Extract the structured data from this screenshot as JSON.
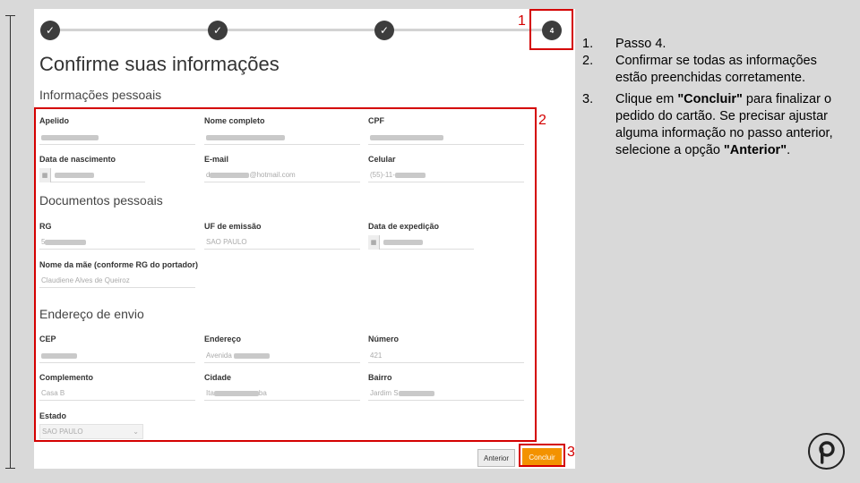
{
  "stepper": {
    "step4_label": "4"
  },
  "page_title": "Confirme suas informações",
  "sections": {
    "personal": "Informações pessoais",
    "documents": "Documentos pessoais",
    "address": "Endereço de envio"
  },
  "fields": {
    "apelido": {
      "label": "Apelido",
      "value": ""
    },
    "nome": {
      "label": "Nome completo",
      "value": ""
    },
    "cpf": {
      "label": "CPF",
      "value": ""
    },
    "nascimento": {
      "label": "Data de nascimento",
      "value": ""
    },
    "email": {
      "label": "E-mail",
      "prefix": "d",
      "suffix": "@hotmail.com"
    },
    "celular": {
      "label": "Celular",
      "prefix": "(55)-11-"
    },
    "rg": {
      "label": "RG",
      "prefix": "5"
    },
    "uf": {
      "label": "UF de emissão",
      "value": "SAO PAULO"
    },
    "expedicao": {
      "label": "Data de expedição",
      "value": ""
    },
    "mae": {
      "label": "Nome da mãe (conforme RG do portador)",
      "value": "Claudiene Alves de Queiroz"
    },
    "cep": {
      "label": "CEP",
      "value": ""
    },
    "endereco": {
      "label": "Endereço",
      "prefix": "Avenida"
    },
    "numero": {
      "label": "Número",
      "value": "421"
    },
    "complemento": {
      "label": "Complemento",
      "value": "Casa B"
    },
    "cidade": {
      "label": "Cidade",
      "prefix": "Ita",
      "suffix": "ba"
    },
    "bairro": {
      "label": "Bairro",
      "prefix": "Jardim S"
    },
    "estado": {
      "label": "Estado",
      "value": "SAO PAULO"
    }
  },
  "buttons": {
    "previous": "Anterior",
    "finish": "Concluir"
  },
  "annotations": [
    "1",
    "2",
    "3"
  ],
  "instructions": [
    {
      "n": "1.",
      "parts": [
        {
          "t": "Passo 4.",
          "b": false
        }
      ]
    },
    {
      "n": "2.",
      "parts": [
        {
          "t": "Confirmar se todas as informações estão preenchidas corretamente.",
          "b": false
        }
      ]
    },
    {
      "n": "3.",
      "parts": [
        {
          "t": "Clique em ",
          "b": false
        },
        {
          "t": "\"Concluir\"",
          "b": true
        },
        {
          "t": " para finalizar o pedido do cartão. Se precisar ajustar alguma informação no passo anterior, selecione a opção ",
          "b": false
        },
        {
          "t": "\"Anterior\"",
          "b": true
        },
        {
          "t": ".",
          "b": false
        }
      ]
    }
  ],
  "colors": {
    "accent": "#f39200",
    "annotation": "#d40000",
    "step": "#3d3d3d"
  },
  "logo": {
    "letter": "p",
    "icon": "brand-logo-icon"
  }
}
